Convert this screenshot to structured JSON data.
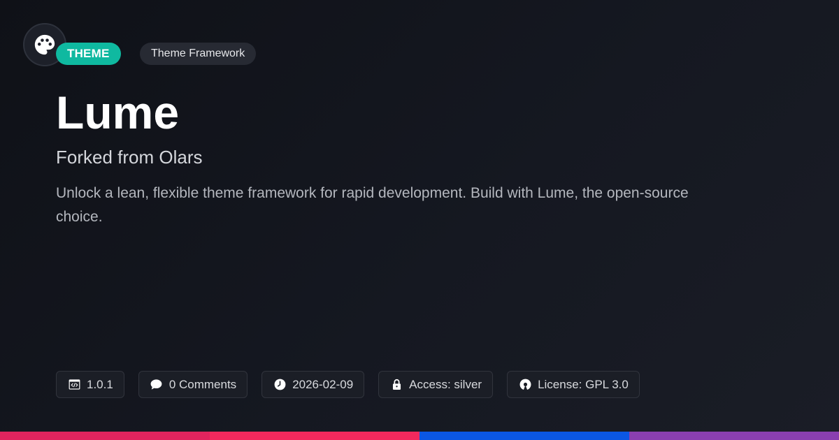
{
  "logo": {
    "icon": "palette-icon"
  },
  "badges": {
    "type_label": "THEME",
    "category_label": "Theme Framework"
  },
  "title": "Lume",
  "subtitle": "Forked from Olars",
  "description": "Unlock a lean, flexible theme framework for rapid development. Build with Lume, the open-source choice.",
  "meta": [
    {
      "icon": "code-window-icon",
      "text": "1.0.1"
    },
    {
      "icon": "comment-icon",
      "text": "0 Comments"
    },
    {
      "icon": "clock-icon",
      "text": "2026-02-09"
    },
    {
      "icon": "lock-icon",
      "text": "Access: silver"
    },
    {
      "icon": "open-source-icon",
      "text": "License: GPL 3.0"
    }
  ],
  "colors": {
    "accent": "#0fb9a0",
    "bar": [
      "#e0245e",
      "#f2295d",
      "#0b57e3",
      "#8a3fb0"
    ]
  }
}
